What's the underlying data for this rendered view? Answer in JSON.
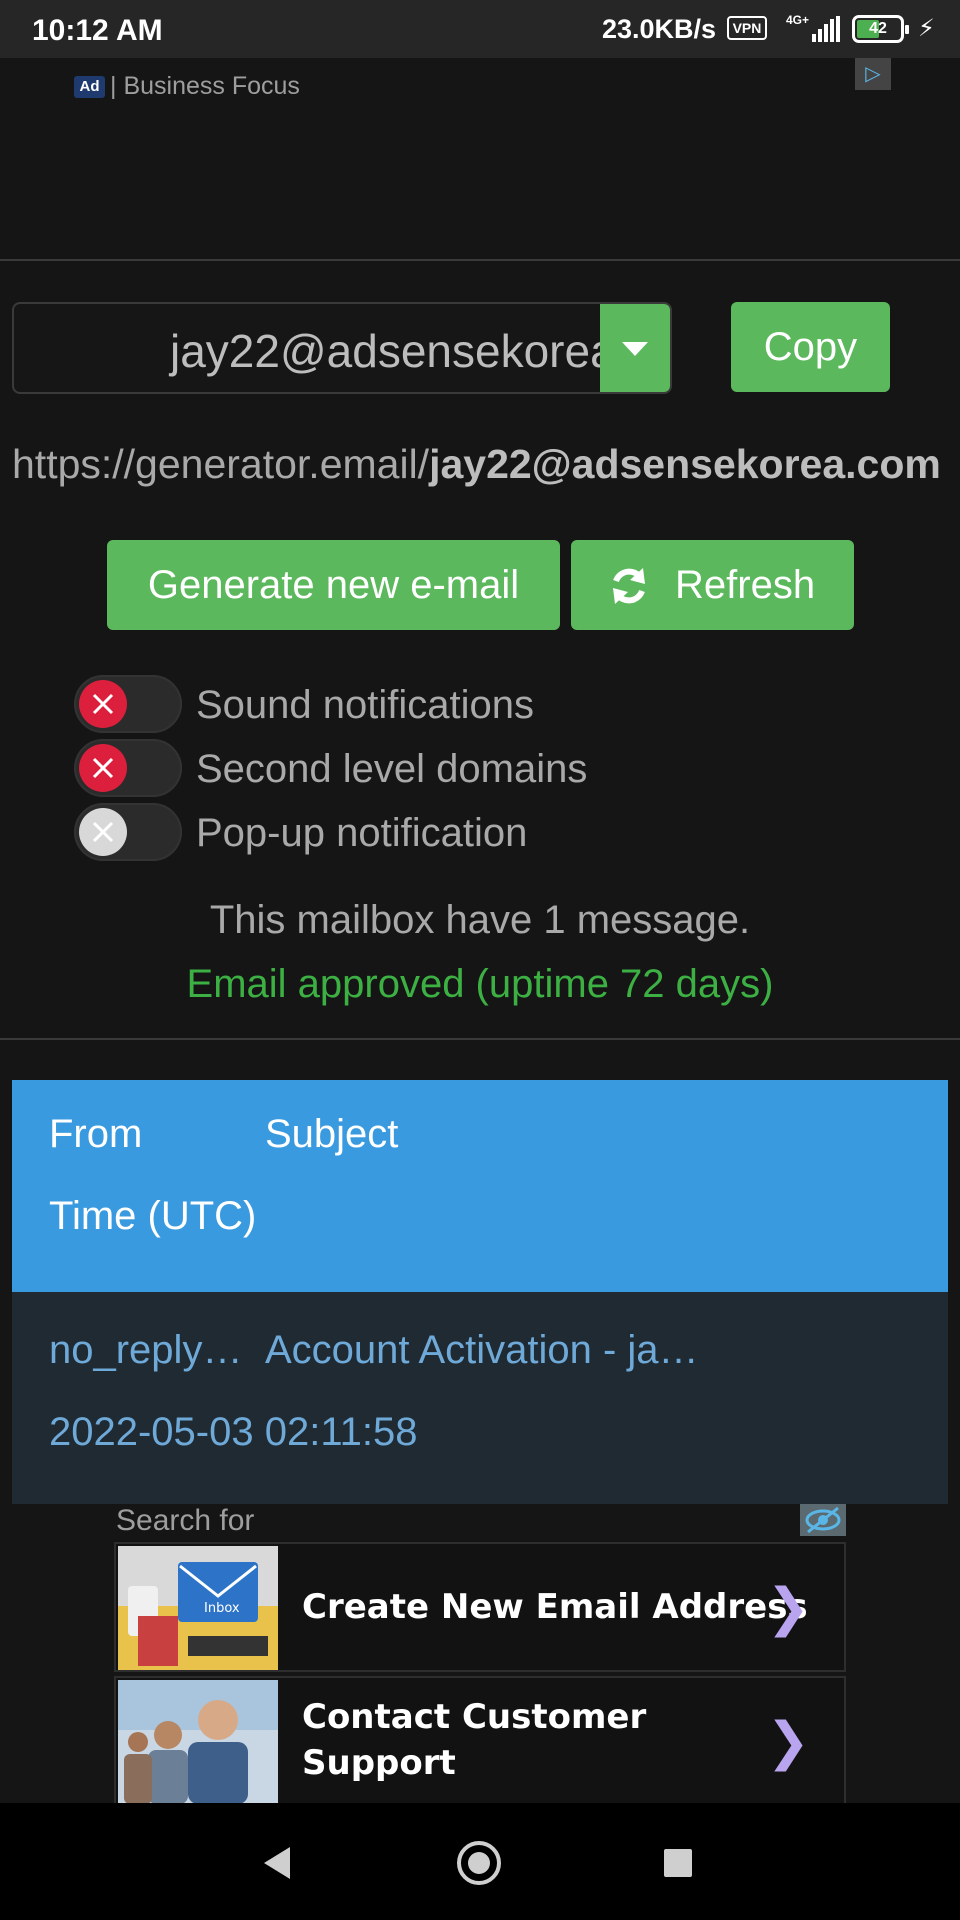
{
  "status_bar": {
    "time": "10:12 AM",
    "net_speed": "23.0KB/s",
    "vpn": "VPN",
    "network": "4G+",
    "battery": "42"
  },
  "ad_banner": {
    "badge": "Ad",
    "source": "| Business Focus"
  },
  "email": {
    "address": "jay22@adsensekorea.com",
    "copy_label": "Copy",
    "url_prefix": "https://generator.email/",
    "url_email": "jay22@adsensekorea.com"
  },
  "actions": {
    "generate_label": "Generate new e-mail",
    "refresh_label": "Refresh"
  },
  "toggles": [
    {
      "label": "Sound notifications",
      "state": "off-red"
    },
    {
      "label": "Second level domains",
      "state": "off-red"
    },
    {
      "label": "Pop-up notification",
      "state": "off-grey"
    }
  ],
  "mailbox": {
    "count_text": "This mailbox have 1 message.",
    "approved_text": "Email approved (uptime 72 days)"
  },
  "table": {
    "headers": {
      "from": "From",
      "subject": "Subject",
      "time": "Time (UTC)"
    },
    "rows": [
      {
        "from": "no_reply…",
        "subject": "Account Activation - ja…",
        "time": "2022-05-03 02:11:58"
      }
    ]
  },
  "search_ad": {
    "header": "Search for",
    "items": [
      {
        "line1": "Create New Email Address",
        "line2": ""
      },
      {
        "line1": "Contact Customer",
        "line2": "Support"
      }
    ]
  },
  "colors": {
    "accent_green": "#5cb85c",
    "table_header_blue": "#3a9ae0",
    "toggle_red": "#dc1f3c",
    "approved_green": "#3cb043"
  }
}
